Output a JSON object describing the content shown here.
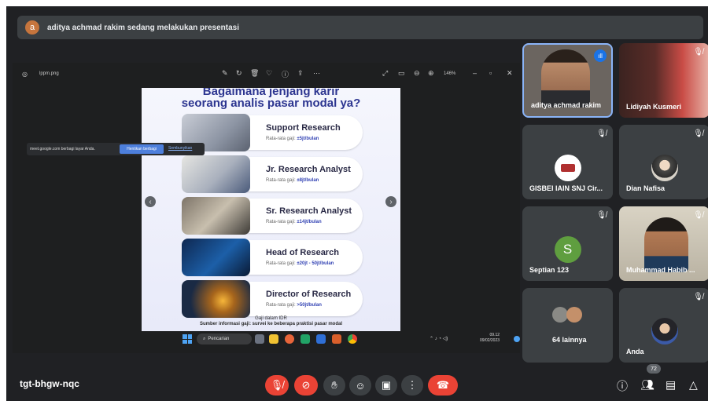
{
  "banner": {
    "avatar_letter": "a",
    "text": "aditya achmad rakim sedang melakukan presentasi"
  },
  "viewer": {
    "filename": "lppm.png",
    "zoom": "146%"
  },
  "share_banner": {
    "text": "meet.google.com berbagi layar Anda.",
    "stop_button": "Hentikan berbagi",
    "hide_link": "Sembunyikan"
  },
  "slide": {
    "title_line1": "Bagaimana jenjang karir",
    "title_line2": "seorang analis pasar modal ya?",
    "salary_prefix": "Rata-rata gaji:",
    "careers": [
      {
        "role": "Support Research",
        "salary": "±5jt/bulan"
      },
      {
        "role": "Jr. Research Analyst",
        "salary": "±8jt/bulan"
      },
      {
        "role": "Sr. Research Analyst",
        "salary": "±14jt/bulan"
      },
      {
        "role": "Head of Research",
        "salary": "±20jt - 50jt/bulan"
      },
      {
        "role": "Director of Research",
        "salary": ">50jt/bulan"
      }
    ],
    "footnote1": "Gaji dalam IDR",
    "footnote2": "Sumber informasi gaji: survei ke beberapa praktisi pasar modal"
  },
  "taskbar": {
    "search": "Pencarian",
    "time": "09.12",
    "date": "09/02/2023"
  },
  "participants": [
    {
      "name": "aditya achmad rakim"
    },
    {
      "name": "Lidiyah Kusmeri"
    },
    {
      "name": "GISBEI IAIN SNJ Cir..."
    },
    {
      "name": "Dian Nafisa"
    },
    {
      "name": "Septian 123",
      "initial": "S"
    },
    {
      "name": "Muhammad Habib ..."
    },
    {
      "name": "64 lainnya"
    },
    {
      "name": "Anda"
    }
  ],
  "meeting": {
    "code": "tgt-bhgw-nqc",
    "participant_count": "72"
  },
  "colors": {
    "background": "#202124",
    "tile": "#3c4043",
    "danger": "#ea4335",
    "accent": "#2c3590"
  }
}
